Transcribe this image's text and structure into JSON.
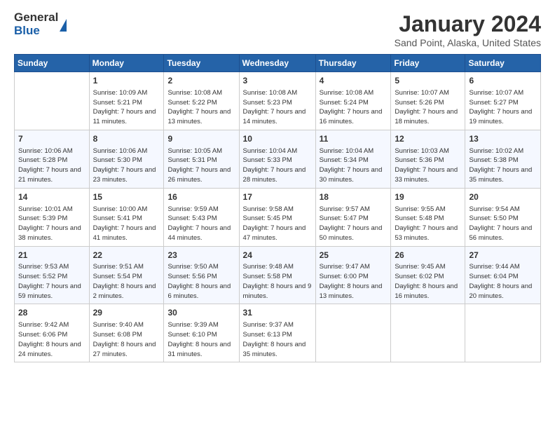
{
  "logo": {
    "general": "General",
    "blue": "Blue"
  },
  "title": {
    "month": "January 2024",
    "location": "Sand Point, Alaska, United States"
  },
  "weekdays": [
    "Sunday",
    "Monday",
    "Tuesday",
    "Wednesday",
    "Thursday",
    "Friday",
    "Saturday"
  ],
  "weeks": [
    [
      {
        "day": "",
        "info": ""
      },
      {
        "day": "1",
        "info": "Sunrise: 10:09 AM\nSunset: 5:21 PM\nDaylight: 7 hours\nand 11 minutes."
      },
      {
        "day": "2",
        "info": "Sunrise: 10:08 AM\nSunset: 5:22 PM\nDaylight: 7 hours\nand 13 minutes."
      },
      {
        "day": "3",
        "info": "Sunrise: 10:08 AM\nSunset: 5:23 PM\nDaylight: 7 hours\nand 14 minutes."
      },
      {
        "day": "4",
        "info": "Sunrise: 10:08 AM\nSunset: 5:24 PM\nDaylight: 7 hours\nand 16 minutes."
      },
      {
        "day": "5",
        "info": "Sunrise: 10:07 AM\nSunset: 5:26 PM\nDaylight: 7 hours\nand 18 minutes."
      },
      {
        "day": "6",
        "info": "Sunrise: 10:07 AM\nSunset: 5:27 PM\nDaylight: 7 hours\nand 19 minutes."
      }
    ],
    [
      {
        "day": "7",
        "info": "Sunrise: 10:06 AM\nSunset: 5:28 PM\nDaylight: 7 hours\nand 21 minutes."
      },
      {
        "day": "8",
        "info": "Sunrise: 10:06 AM\nSunset: 5:30 PM\nDaylight: 7 hours\nand 23 minutes."
      },
      {
        "day": "9",
        "info": "Sunrise: 10:05 AM\nSunset: 5:31 PM\nDaylight: 7 hours\nand 26 minutes."
      },
      {
        "day": "10",
        "info": "Sunrise: 10:04 AM\nSunset: 5:33 PM\nDaylight: 7 hours\nand 28 minutes."
      },
      {
        "day": "11",
        "info": "Sunrise: 10:04 AM\nSunset: 5:34 PM\nDaylight: 7 hours\nand 30 minutes."
      },
      {
        "day": "12",
        "info": "Sunrise: 10:03 AM\nSunset: 5:36 PM\nDaylight: 7 hours\nand 33 minutes."
      },
      {
        "day": "13",
        "info": "Sunrise: 10:02 AM\nSunset: 5:38 PM\nDaylight: 7 hours\nand 35 minutes."
      }
    ],
    [
      {
        "day": "14",
        "info": "Sunrise: 10:01 AM\nSunset: 5:39 PM\nDaylight: 7 hours\nand 38 minutes."
      },
      {
        "day": "15",
        "info": "Sunrise: 10:00 AM\nSunset: 5:41 PM\nDaylight: 7 hours\nand 41 minutes."
      },
      {
        "day": "16",
        "info": "Sunrise: 9:59 AM\nSunset: 5:43 PM\nDaylight: 7 hours\nand 44 minutes."
      },
      {
        "day": "17",
        "info": "Sunrise: 9:58 AM\nSunset: 5:45 PM\nDaylight: 7 hours\nand 47 minutes."
      },
      {
        "day": "18",
        "info": "Sunrise: 9:57 AM\nSunset: 5:47 PM\nDaylight: 7 hours\nand 50 minutes."
      },
      {
        "day": "19",
        "info": "Sunrise: 9:55 AM\nSunset: 5:48 PM\nDaylight: 7 hours\nand 53 minutes."
      },
      {
        "day": "20",
        "info": "Sunrise: 9:54 AM\nSunset: 5:50 PM\nDaylight: 7 hours\nand 56 minutes."
      }
    ],
    [
      {
        "day": "21",
        "info": "Sunrise: 9:53 AM\nSunset: 5:52 PM\nDaylight: 7 hours\nand 59 minutes."
      },
      {
        "day": "22",
        "info": "Sunrise: 9:51 AM\nSunset: 5:54 PM\nDaylight: 8 hours\nand 2 minutes."
      },
      {
        "day": "23",
        "info": "Sunrise: 9:50 AM\nSunset: 5:56 PM\nDaylight: 8 hours\nand 6 minutes."
      },
      {
        "day": "24",
        "info": "Sunrise: 9:48 AM\nSunset: 5:58 PM\nDaylight: 8 hours\nand 9 minutes."
      },
      {
        "day": "25",
        "info": "Sunrise: 9:47 AM\nSunset: 6:00 PM\nDaylight: 8 hours\nand 13 minutes."
      },
      {
        "day": "26",
        "info": "Sunrise: 9:45 AM\nSunset: 6:02 PM\nDaylight: 8 hours\nand 16 minutes."
      },
      {
        "day": "27",
        "info": "Sunrise: 9:44 AM\nSunset: 6:04 PM\nDaylight: 8 hours\nand 20 minutes."
      }
    ],
    [
      {
        "day": "28",
        "info": "Sunrise: 9:42 AM\nSunset: 6:06 PM\nDaylight: 8 hours\nand 24 minutes."
      },
      {
        "day": "29",
        "info": "Sunrise: 9:40 AM\nSunset: 6:08 PM\nDaylight: 8 hours\nand 27 minutes."
      },
      {
        "day": "30",
        "info": "Sunrise: 9:39 AM\nSunset: 6:10 PM\nDaylight: 8 hours\nand 31 minutes."
      },
      {
        "day": "31",
        "info": "Sunrise: 9:37 AM\nSunset: 6:13 PM\nDaylight: 8 hours\nand 35 minutes."
      },
      {
        "day": "",
        "info": ""
      },
      {
        "day": "",
        "info": ""
      },
      {
        "day": "",
        "info": ""
      }
    ]
  ]
}
